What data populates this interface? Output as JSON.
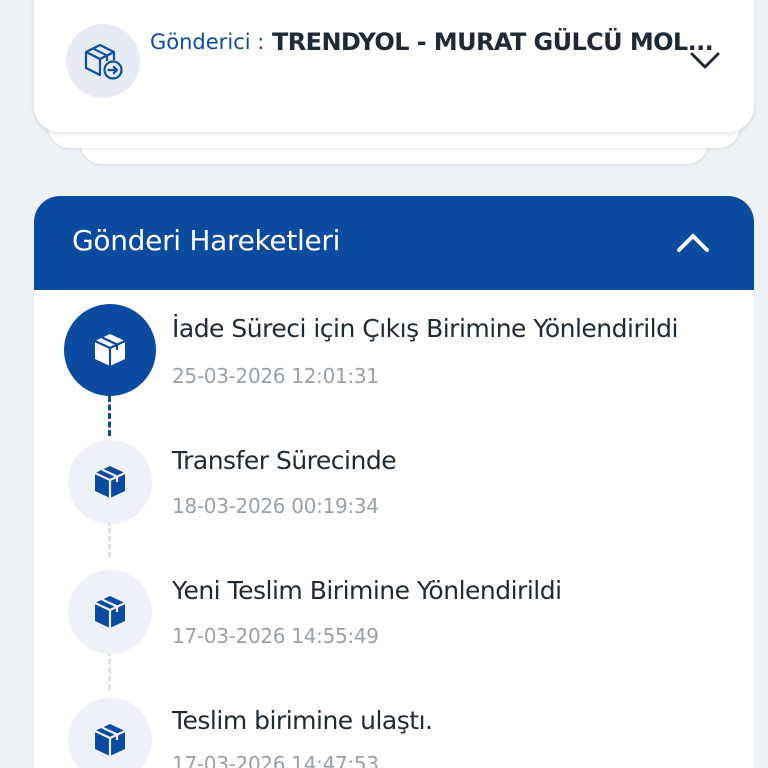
{
  "sender": {
    "label": "Gönderici :",
    "name": "TRENDYOL - MURAT GÜLCÜ MOL...",
    "icon": "box-forward-icon"
  },
  "movements": {
    "title": "Gönderi Hareketleri",
    "accent_color": "#0a4a9f",
    "items": [
      {
        "title": "İade Süreci için Çıkış Birimine Yönlendirildi",
        "date": "25-03-2026 12:01:31",
        "active": true,
        "icon": "package-icon"
      },
      {
        "title": "Transfer Sürecinde",
        "date": "18-03-2026 00:19:34",
        "active": false,
        "icon": "package-icon"
      },
      {
        "title": "Yeni Teslim Birimine Yönlendirildi",
        "date": "17-03-2026 14:55:49",
        "active": false,
        "icon": "package-icon"
      },
      {
        "title": "Teslim birimine ulaştı.",
        "date": "17-03-2026 14:47:53",
        "active": false,
        "icon": "package-icon"
      }
    ]
  }
}
